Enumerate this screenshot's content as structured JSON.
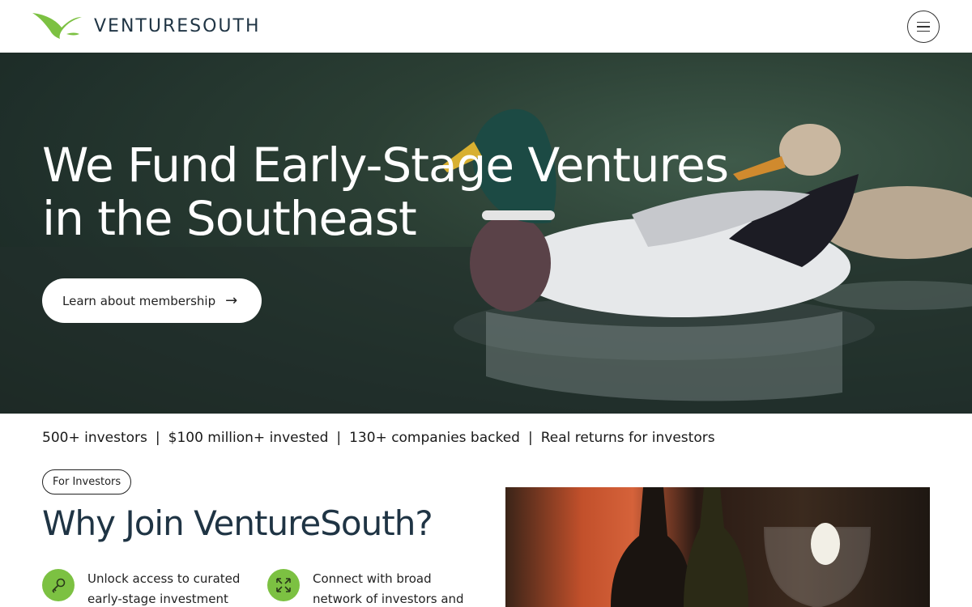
{
  "header": {
    "brand_name": "VENTURESOUTH",
    "logo_icon": "bird-logo-icon",
    "menu_icon": "hamburger-menu-icon",
    "brand_color": "#7cc142",
    "text_color": "#1f3444"
  },
  "hero": {
    "title_line1": "We Fund Early-Stage Ventures",
    "title_line2": "in the Southeast",
    "cta_label": "Learn about membership",
    "cta_icon": "arrow-right-icon"
  },
  "stats": {
    "items": [
      "500+ investors",
      "$100 million+ invested",
      "130+ companies backed",
      "Real returns for investors"
    ],
    "separator": "|"
  },
  "section": {
    "badge": "For Investors",
    "title": "Why Join VentureSouth?",
    "features": [
      {
        "icon": "key-icon",
        "text": "Unlock access to curated early-stage investment"
      },
      {
        "icon": "expand-arrows-icon",
        "text": "Connect with broad network of investors and"
      }
    ]
  }
}
